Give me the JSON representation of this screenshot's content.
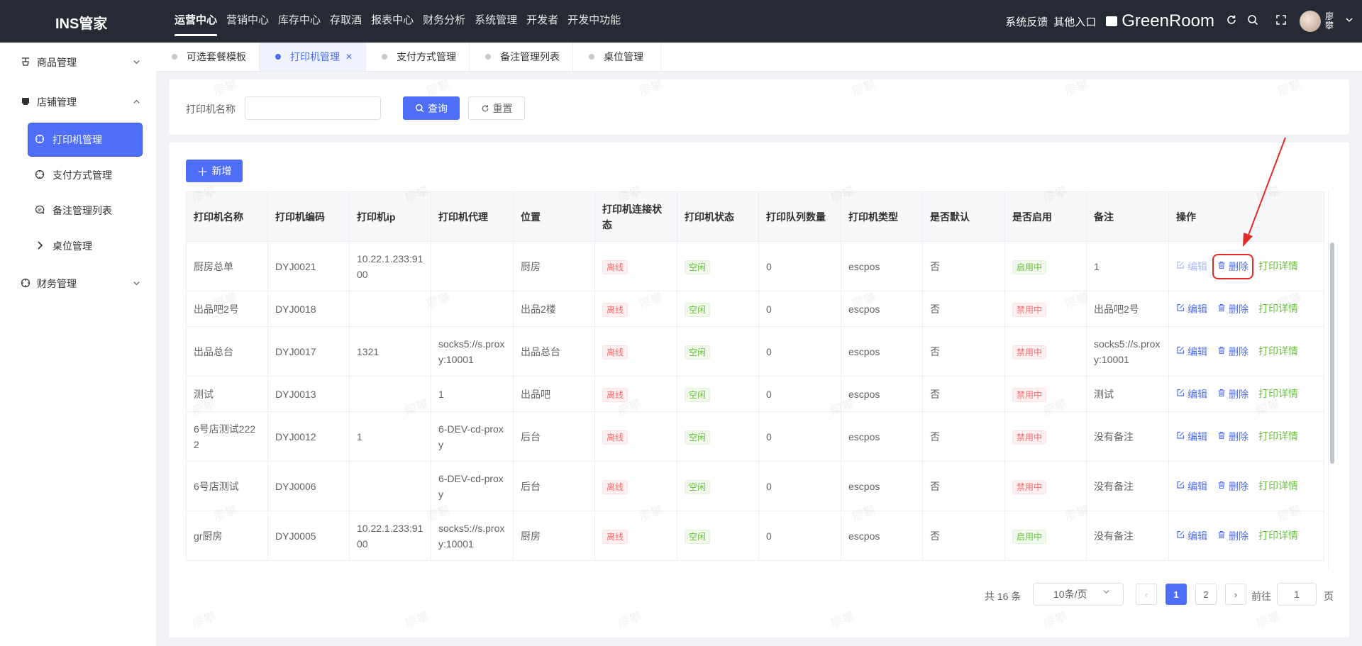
{
  "app": {
    "title": "INS管家"
  },
  "top_nav": [
    {
      "label": "运营中心",
      "active": true
    },
    {
      "label": "营销中心"
    },
    {
      "label": "库存中心"
    },
    {
      "label": "存取酒"
    },
    {
      "label": "报表中心"
    },
    {
      "label": "财务分析"
    },
    {
      "label": "系统管理"
    },
    {
      "label": "开发者"
    },
    {
      "label": "开发中功能"
    }
  ],
  "top_right": {
    "feedback": "系统反馈",
    "other_entry": "其他入口",
    "store_name": "GreenRoom",
    "user_name": "廖攀",
    "icons": [
      "store-icon",
      "refresh-icon",
      "search-icon",
      "fullscreen-icon",
      "chevron-down-icon"
    ]
  },
  "sidebar": {
    "groups": [
      {
        "label": "商品管理",
        "icon": "product-icon",
        "expanded": false
      },
      {
        "label": "店铺管理",
        "icon": "shop-icon",
        "expanded": true,
        "items": [
          {
            "label": "打印机管理",
            "icon": "crosshair-icon",
            "active": true
          },
          {
            "label": "支付方式管理",
            "icon": "crosshair-icon"
          },
          {
            "label": "备注管理列表",
            "icon": "comment-icon"
          },
          {
            "label": "桌位管理",
            "icon": "chevron-right-icon"
          }
        ]
      },
      {
        "label": "财务管理",
        "icon": "crosshair-icon",
        "expanded": false
      }
    ]
  },
  "tabs": [
    {
      "label": "可选套餐模板"
    },
    {
      "label": "打印机管理",
      "active": true,
      "closable": true
    },
    {
      "label": "支付方式管理"
    },
    {
      "label": "备注管理列表"
    },
    {
      "label": "桌位管理"
    }
  ],
  "search": {
    "label": "打印机名称",
    "value": "",
    "query_button": "查询",
    "reset_button": "重置"
  },
  "toolbar": {
    "add_button": "新增"
  },
  "table": {
    "columns": [
      "打印机名称",
      "打印机编码",
      "打印机ip",
      "打印机代理",
      "位置",
      "打印机连接状态",
      "打印机状态",
      "打印队列数量",
      "打印机类型",
      "是否默认",
      "是否启用",
      "备注",
      "操作"
    ],
    "rows": [
      {
        "name": "厨房总单",
        "code": "DYJ0021",
        "ip": "10.22.1.233:9100",
        "proxy": "",
        "location": "厨房",
        "conn": "离线",
        "status": "空闲",
        "queue": "0",
        "type": "escpos",
        "default": "否",
        "enabled": "启用中",
        "remark": "1"
      },
      {
        "name": "出品吧2号",
        "code": "DYJ0018",
        "ip": "",
        "proxy": "",
        "location": "出品2楼",
        "conn": "离线",
        "status": "空闲",
        "queue": "0",
        "type": "escpos",
        "default": "否",
        "enabled": "禁用中",
        "remark": "出品吧2号"
      },
      {
        "name": "出品总台",
        "code": "DYJ0017",
        "ip": "1321",
        "proxy": "socks5://s.proxy:10001",
        "location": "出品总台",
        "conn": "离线",
        "status": "空闲",
        "queue": "0",
        "type": "escpos",
        "default": "否",
        "enabled": "禁用中",
        "remark": "socks5://s.proxy:10001"
      },
      {
        "name": "测试",
        "code": "DYJ0013",
        "ip": "",
        "proxy": "1",
        "location": "出品吧",
        "conn": "离线",
        "status": "空闲",
        "queue": "0",
        "type": "escpos",
        "default": "否",
        "enabled": "禁用中",
        "remark": "测试"
      },
      {
        "name": "6号店测试2222",
        "code": "DYJ0012",
        "ip": "1",
        "proxy": "6-DEV-cd-proxy",
        "location": "后台",
        "conn": "离线",
        "status": "空闲",
        "queue": "0",
        "type": "escpos",
        "default": "否",
        "enabled": "禁用中",
        "remark": "没有备注"
      },
      {
        "name": "6号店测试",
        "code": "DYJ0006",
        "ip": "",
        "proxy": "6-DEV-cd-proxy",
        "location": "后台",
        "conn": "离线",
        "status": "空闲",
        "queue": "0",
        "type": "escpos",
        "default": "否",
        "enabled": "禁用中",
        "remark": "没有备注"
      },
      {
        "name": "gr厨房",
        "code": "DYJ0005",
        "ip": "10.22.1.233:9100",
        "proxy": "socks5://s.proxy:10001",
        "location": "厨房",
        "conn": "离线",
        "status": "空闲",
        "queue": "0",
        "type": "escpos",
        "default": "否",
        "enabled": "启用中",
        "remark": "没有备注"
      }
    ],
    "actions": {
      "edit": "编辑",
      "delete": "删除",
      "detail": "打印详情"
    }
  },
  "pagination": {
    "total_text": "共 16 条",
    "page_size": "10条/页",
    "pages": [
      "1",
      "2"
    ],
    "current": "1",
    "goto_label": "前往",
    "goto_value": "1",
    "goto_unit": "页"
  },
  "watermark": "廖攀",
  "colors": {
    "topbar": "#252a34",
    "primary": "#4f6ef7",
    "danger": "#f56c6c",
    "success": "#67c23a",
    "annotation": "#e12a2a"
  }
}
